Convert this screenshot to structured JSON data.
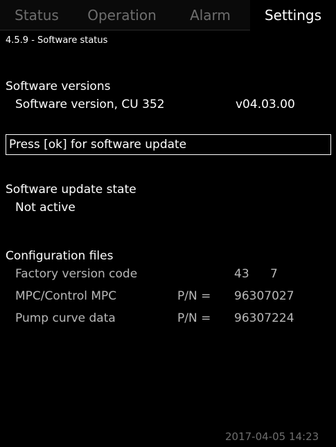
{
  "tabs": [
    {
      "label": "Status",
      "active": false
    },
    {
      "label": "Operation",
      "active": false
    },
    {
      "label": "Alarm",
      "active": false
    },
    {
      "label": "Settings",
      "active": true
    }
  ],
  "breadcrumb": "4.5.9 - Software status",
  "software_versions": {
    "heading": "Software versions",
    "items": [
      {
        "label": "Software version, CU 352",
        "value": "v04.03.00"
      }
    ]
  },
  "update_prompt": "Press [ok] for software update",
  "update_state": {
    "heading": "Software update state",
    "value": "Not active"
  },
  "configuration_files": {
    "heading": "Configuration files",
    "items": [
      {
        "label": "Factory version code",
        "pn": "",
        "value1": "43",
        "value2": "7"
      },
      {
        "label": "MPC/Control MPC",
        "pn": "P/N =",
        "value1": "96307027",
        "value2": ""
      },
      {
        "label": "Pump curve data",
        "pn": "P/N =",
        "value1": "96307224",
        "value2": ""
      }
    ]
  },
  "timestamp": "2017-04-05 14:23",
  "colors": {
    "background": "#000000",
    "text": "#ffffff",
    "inactive_tab_text": "#6e6e6e",
    "selection_border": "#ffffff"
  }
}
